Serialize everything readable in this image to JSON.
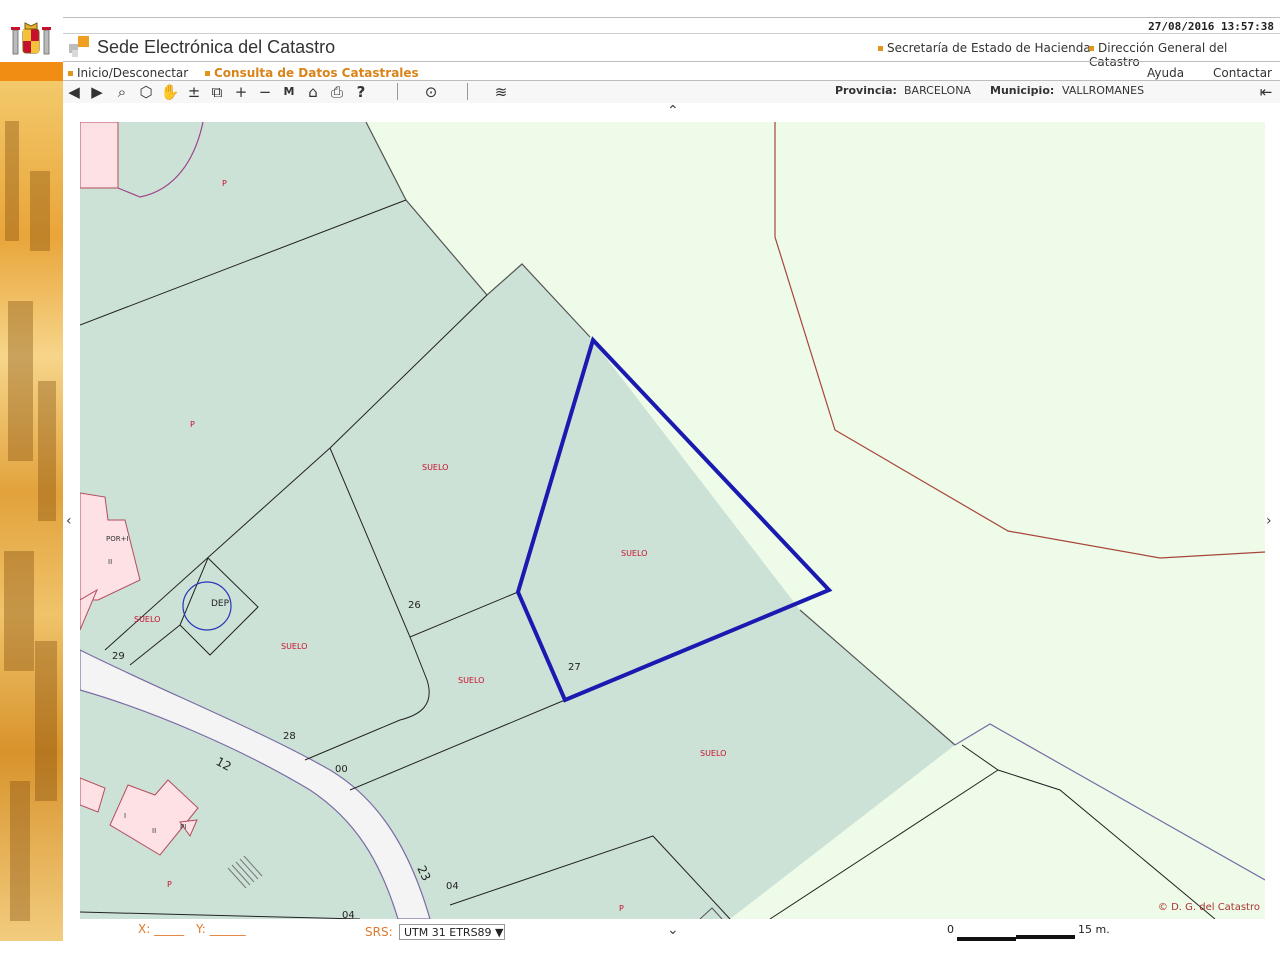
{
  "header": {
    "datetime": "27/08/2016  13:57:38",
    "app_title": "Sede Electrónica del Catastro",
    "links": [
      "Secretaría de Estado de Hacienda",
      "Dirección General del Catastro"
    ]
  },
  "nav": {
    "left": [
      "Inicio/Desconectar",
      "Consulta de Datos Catastrales"
    ],
    "right": [
      "Ayuda",
      "Contactar"
    ]
  },
  "toolbar": {
    "tools": [
      "back-icon",
      "forward-icon",
      "zoom-search-icon",
      "3d-cube-icon",
      "pan-hand-icon",
      "zoom-extent-icon",
      "zoom-window-icon",
      "zoom-in-icon",
      "zoom-out-icon",
      "measure-icon",
      "home-parcel-icon",
      "print-icon",
      "help-icon",
      "locate-pin-icon",
      "layers-icon"
    ],
    "provincia_label": "Provincia:",
    "provincia_value": "BARCELONA",
    "municipio_label": "Municipio:",
    "municipio_value": "VALLROMANES"
  },
  "map": {
    "labels": {
      "p1": "P",
      "p2": "P",
      "p3": "P",
      "p4": "P",
      "suelo1": "SUELO",
      "suelo2": "SUELO",
      "suelo3": "SUELO",
      "suelo4": "SUELO",
      "suelo5": "SUELO",
      "suelo6": "SUELO",
      "dep": "DEP",
      "por": "POR+I",
      "ii1": "II",
      "ii2": "II",
      "i1": "I",
      "pi": "PI",
      "n26": "26",
      "n27": "27",
      "n28": "28",
      "n29": "29",
      "n00": "00",
      "n04a": "04",
      "n04b": "04",
      "road12": "12",
      "road23": "23"
    },
    "colors": {
      "parcel_fill": "#cde2d7",
      "free_fill": "#eefbe8",
      "road_fill": "#f4f4f4",
      "building_fill": "#fde1e4",
      "selected_parcel": "#1b1ab0",
      "label_red": "#c8102e"
    },
    "copyright": "© D. G. del Catastro"
  },
  "footer": {
    "x_label": "X: _____",
    "y_label": "Y: ______",
    "srs_label": "SRS:",
    "srs_value": "UTM 31 ETRS89 ▼",
    "scale_start": "0",
    "scale_end": "15 m."
  }
}
